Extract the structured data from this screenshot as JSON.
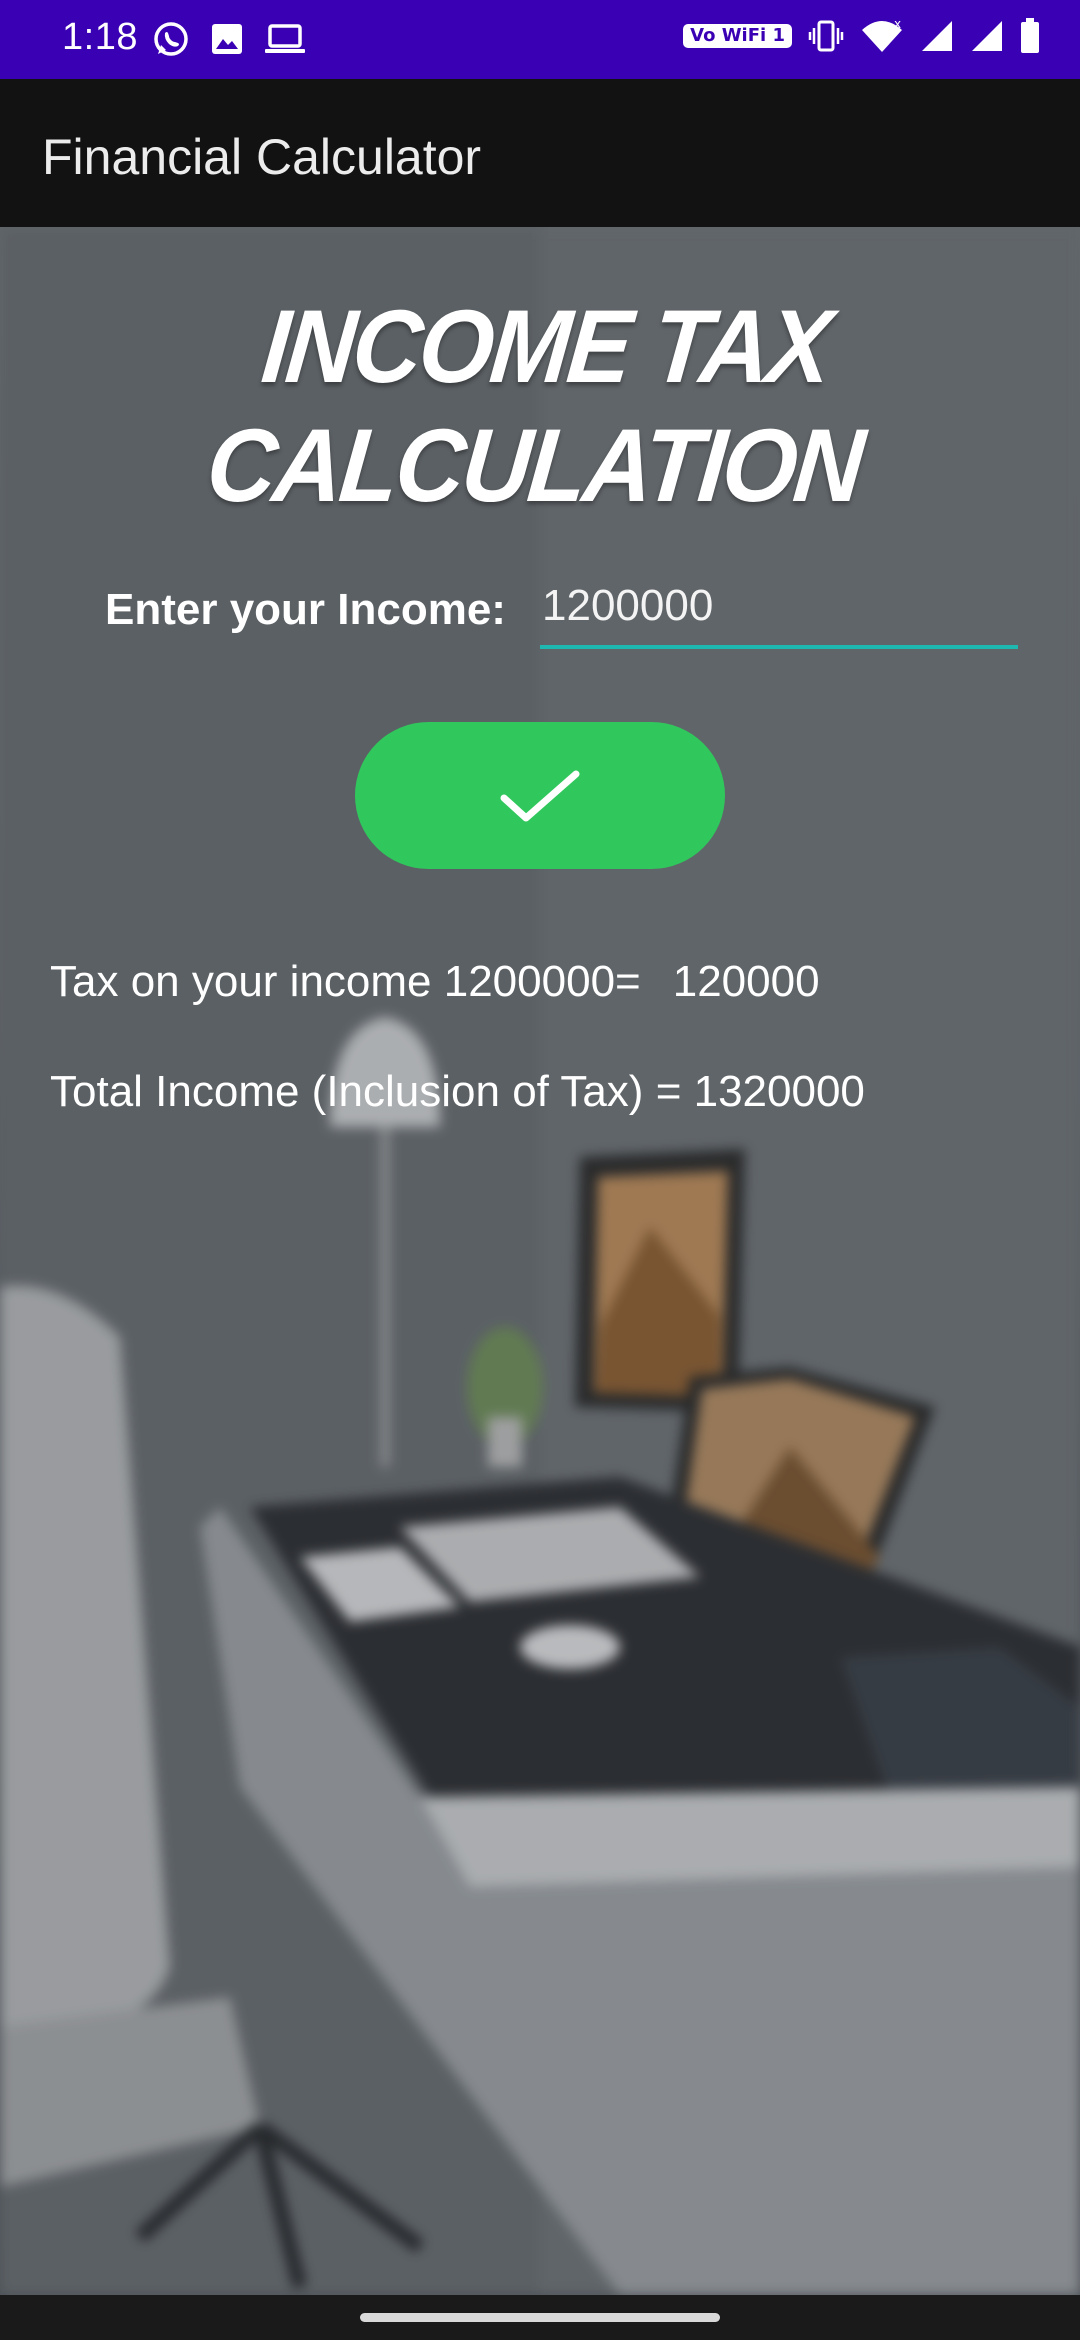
{
  "status_bar": {
    "time": "1:18",
    "left_icons": [
      "whatsapp-icon",
      "image-icon",
      "laptop-icon"
    ],
    "wifi_badge": "Vo WiFi 1",
    "right_icons": [
      "vibrate-icon",
      "wifi-icon",
      "signal-icon",
      "signal-icon",
      "battery-icon"
    ],
    "color": "#3a00b4"
  },
  "app_bar": {
    "title": "Financial Calculator"
  },
  "main": {
    "heading": "INCOME TAX CALCULATION",
    "income_label": "Enter your Income:",
    "income_value": "1200000",
    "calculate_button_icon": "checkmark-icon",
    "tax_result_label": "Tax on your income 1200000=",
    "tax_result_value": "120000",
    "total_result": "Total Income (Inclusion of Tax) = 1320000"
  },
  "colors": {
    "accent": "#30c85c",
    "input_underline": "#1fb8b0",
    "app_bar": "#121212"
  }
}
